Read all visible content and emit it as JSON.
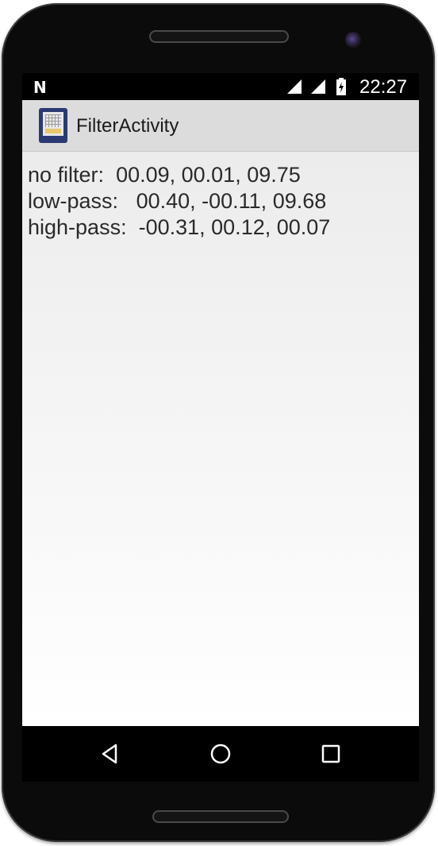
{
  "status_bar": {
    "notification_icon": "n-notification-icon",
    "time": "22:27"
  },
  "action_bar": {
    "app_icon": "filter-app-icon",
    "title": "FilterActivity"
  },
  "readings": [
    {
      "label": "no filter:",
      "values": "00.09, 00.01, 09.75"
    },
    {
      "label": "low-pass:",
      "values": "00.40, -00.11, 09.68"
    },
    {
      "label": "high-pass:",
      "values": "-00.31, 00.12, 00.07"
    }
  ],
  "nav_bar": {
    "back": "back-triangle-icon",
    "home": "home-circle-icon",
    "recents": "recents-square-icon"
  }
}
